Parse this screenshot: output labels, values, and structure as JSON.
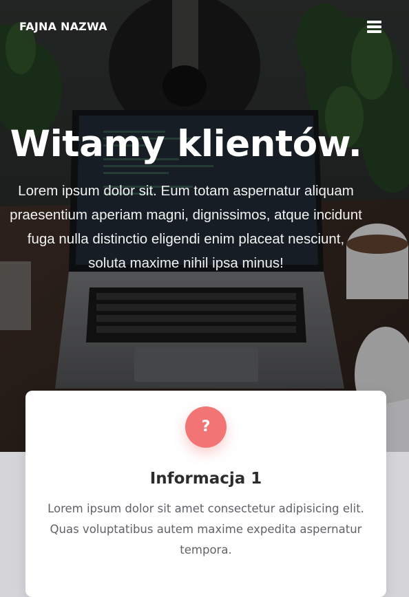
{
  "nav": {
    "brand": "FAJNA NAZWA",
    "menu_icon": "hamburger-menu-icon"
  },
  "hero": {
    "title": "Witamy klientów.",
    "text": "Lorem ipsum dolor sit. Eum totam aspernatur aliquam praesentium aperiam magni, dignissimos, atque incidunt fuga nulla distinctio eligendi enim placeat nesciunt, soluta maxime nihil ipsa minus!",
    "background_image": "laptop on desk with guitar and plants"
  },
  "card": {
    "icon": "question-mark-icon",
    "icon_glyph": "?",
    "title": "Informacja 1",
    "text": "Lorem ipsum dolor sit amet consectetur adipisicing elit. Quas voluptatibus autem maxime expedita aspernatur tempora."
  },
  "colors": {
    "accent": "#f27474",
    "section_background": "#d5d4d9",
    "card_background": "#ffffff"
  }
}
